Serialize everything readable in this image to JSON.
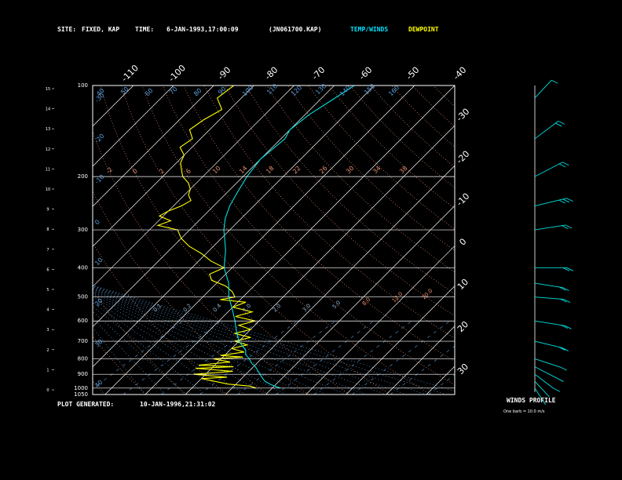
{
  "header": {
    "site_label": "SITE:",
    "site_value": "FIXED, KAP",
    "time_label": "TIME:",
    "time_value": "6-JAN-1993,17:00:09",
    "file_id": "(JN061700.KAP)",
    "temp_winds_label": "TEMP/WINDS",
    "dewpoint_label": "DEWPOINT"
  },
  "footer": {
    "generated_label": "PLOT GENERATED:",
    "generated_value": "10-JAN-1996,21:31:02"
  },
  "winds_panel": {
    "title": "WINDS PROFILE",
    "note": "One barb = 10.0 m/s"
  },
  "colors": {
    "background": "#000000",
    "frame": "#ffffff",
    "isobar": "#ffffff",
    "isotherm": "#ffffff",
    "dry_adiabat": "#e89070",
    "moist_adiabat": "#5aa0e0",
    "mixing_ratio": "#5aa0e0",
    "temperature": "#00e0e0",
    "dewpoint": "#ffff00",
    "winds": "#00e0e0",
    "header_cyan": "#00e0ff",
    "header_yellow": "#ffff00"
  },
  "chart_data": {
    "type": "line",
    "diagram": "skew-T log-P",
    "ylabel_left": "",
    "ylabel_right": "",
    "pressure_range_hpa": [
      1050,
      100
    ],
    "isobars_hpa": [
      100,
      200,
      300,
      400,
      500,
      600,
      700,
      800,
      900,
      1000,
      1050
    ],
    "height_ticks_km": [
      "0",
      "1",
      "2",
      "3",
      "4",
      "5",
      "6",
      "7",
      "8",
      "9",
      "10",
      "11",
      "12",
      "13",
      "14",
      "15"
    ],
    "top_isotherm_labels": [
      "-110",
      "-100",
      "-90",
      "-80",
      "-70",
      "-60",
      "-50",
      "-40"
    ],
    "right_isotherm_labels": [
      "-30",
      "-20",
      "-10",
      "0",
      "10",
      "20",
      "30"
    ],
    "adiabat_labels_top": [
      "40",
      "50",
      "60",
      "70",
      "80",
      "90",
      "100",
      "110",
      "120",
      "130",
      "140",
      "150",
      "160"
    ],
    "adiabat_labels_mid": [
      "-2",
      "0",
      "2",
      "6",
      "10",
      "14",
      "18",
      "22",
      "26",
      "30",
      "34",
      "38"
    ],
    "moist_labels_left": [
      "40",
      "30",
      "20",
      "10",
      "0",
      "-10",
      "-20",
      "-30"
    ],
    "mixing_labels": [
      "0.1",
      "0.2",
      "0.4",
      "1.0",
      "2.0",
      "3.0",
      "5.0",
      "8.0",
      "12.0",
      "20.0"
    ],
    "series": [
      {
        "name": "TEMP/WINDS",
        "pressure_hpa": [
          1000,
          975,
          950,
          925,
          900,
          875,
          850,
          825,
          800,
          775,
          750,
          700,
          650,
          600,
          550,
          500,
          450,
          400,
          350,
          300,
          275,
          250,
          225,
          200,
          175,
          150,
          140,
          125,
          112,
          100
        ],
        "temperature_c": [
          -8.0,
          -11.0,
          -13.5,
          -15.0,
          -16.5,
          -18.0,
          -19.5,
          -21.5,
          -23.0,
          -25.0,
          -26.0,
          -30.0,
          -33.0,
          -36.0,
          -39.5,
          -43.5,
          -47.0,
          -52.0,
          -56.0,
          -61.5,
          -64.0,
          -66.0,
          -67.5,
          -69.0,
          -70.0,
          -69.0,
          -70.0,
          -69.0,
          -67.0,
          -65.0
        ]
      },
      {
        "name": "DEWPOINT",
        "pressure_hpa": [
          1000,
          985,
          970,
          950,
          930,
          920,
          900,
          880,
          860,
          850,
          840,
          820,
          800,
          790,
          780,
          760,
          740,
          720,
          700,
          680,
          660,
          640,
          620,
          600,
          580,
          560,
          540,
          520,
          510,
          500,
          480,
          460,
          440,
          420,
          400,
          380,
          360,
          340,
          320,
          300,
          290,
          280,
          270,
          260,
          250,
          240,
          230,
          220,
          210,
          200,
          190,
          180,
          170,
          160,
          150,
          140,
          130,
          120,
          110,
          100
        ],
        "dewpoint_c": [
          -14.0,
          -16.0,
          -22.0,
          -26.0,
          -30.0,
          -24.0,
          -33.0,
          -24.0,
          -34.0,
          -25.0,
          -34.0,
          -27.0,
          -32.0,
          -25.0,
          -31.0,
          -26.0,
          -30.0,
          -27.0,
          -31.0,
          -28.0,
          -33.0,
          -30.0,
          -34.0,
          -31.0,
          -37.0,
          -34.0,
          -40.0,
          -38.0,
          -45.0,
          -42.0,
          -44.0,
          -47.0,
          -52.0,
          -54.0,
          -52.0,
          -57.0,
          -61.0,
          -66.0,
          -70.0,
          -73.0,
          -79.0,
          -77.0,
          -81.0,
          -80.0,
          -78.0,
          -77.0,
          -79.0,
          -80.0,
          -82.0,
          -85.0,
          -87.0,
          -89.0,
          -90.0,
          -93.0,
          -92.0,
          -95.0,
          -94.0,
          -92.0,
          -96.0,
          -95.0
        ]
      }
    ],
    "winds": {
      "units": "m/s",
      "barb_value": 10.0,
      "pressure_hpa": [
        1000,
        950,
        900,
        850,
        800,
        700,
        600,
        500,
        450,
        400,
        300,
        250,
        200,
        150,
        110
      ],
      "speed_ms": [
        5,
        8,
        12,
        15,
        18,
        20,
        25,
        22,
        20,
        28,
        26,
        30,
        28,
        25,
        15
      ],
      "direction_deg": [
        210,
        220,
        230,
        240,
        250,
        255,
        260,
        265,
        260,
        270,
        280,
        285,
        300,
        310,
        320
      ]
    }
  }
}
